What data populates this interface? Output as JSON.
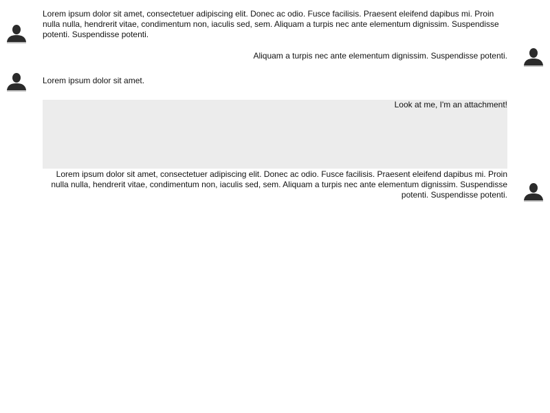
{
  "messages": [
    {
      "side": "left",
      "text": "Lorem ipsum dolor sit amet, consectetuer adipiscing elit. Donec ac odio. Fusce facilisis. Praesent eleifend dapibus mi. Proin nulla nulla, hendrerit vitae, condimentum non, iaculis sed, sem. Aliquam a turpis nec ante elementum dignissim. Suspendisse potenti. Suspendisse potenti."
    },
    {
      "side": "right",
      "text": "Aliquam a turpis nec ante elementum dignissim. Suspendisse potenti."
    },
    {
      "side": "left",
      "text": "Lorem ipsum dolor sit amet."
    },
    {
      "side": "right",
      "attachment_label": "Look at me, I'm an attachment!",
      "text": "Lorem ipsum dolor sit amet, consectetuer adipiscing elit. Donec ac odio. Fusce facilisis. Praesent eleifend dapibus mi. Proin nulla nulla, hendrerit vitae, condimentum non, iaculis sed, sem. Aliquam a turpis nec ante elementum dignissim. Suspendisse potenti. Suspendisse potenti."
    }
  ],
  "icons": {
    "avatar": "user-silhouette-icon"
  },
  "colors": {
    "attachment_bg": "#ececec",
    "avatar": "#2b2b2b",
    "text": "#111111"
  }
}
